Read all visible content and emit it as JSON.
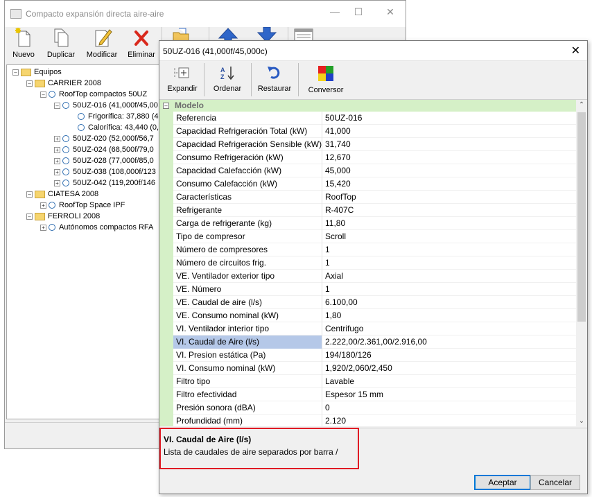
{
  "background_window": {
    "title": "Compacto expansión directa aire-aire",
    "toolbar": [
      {
        "label": "Nuevo",
        "icon": "new-document-icon"
      },
      {
        "label": "Duplicar",
        "icon": "duplicate-icon"
      },
      {
        "label": "Modificar",
        "icon": "edit-pencil-icon"
      },
      {
        "label": "Eliminar",
        "icon": "delete-x-icon"
      }
    ],
    "tree": [
      {
        "label": "Equipos"
      },
      {
        "label": "CARRIER 2008"
      },
      {
        "label": "RoofTop compactos 50UZ"
      },
      {
        "label": "50UZ-016 (41,000f/45,00"
      },
      {
        "label": "Frigorífica: 37,880 (4"
      },
      {
        "label": "Calorífica: 43,440 (0,"
      },
      {
        "label": "50UZ-020 (52,000f/56,7"
      },
      {
        "label": "50UZ-024 (68,500f/79,0"
      },
      {
        "label": "50UZ-028 (77,000f/85,0"
      },
      {
        "label": "50UZ-038 (108,000f/123"
      },
      {
        "label": "50UZ-042 (119,200f/146"
      },
      {
        "label": "CIATESA 2008"
      },
      {
        "label": "RoofTop Space IPF"
      },
      {
        "label": "FERROLI 2008"
      },
      {
        "label": "Autónomos compactos RFA"
      }
    ]
  },
  "dialog": {
    "title": "50UZ-016 (41,000f/45,000c)",
    "toolbar": {
      "expand": "Expandir",
      "sort": "Ordenar",
      "restore": "Restaurar",
      "converter": "Conversor"
    },
    "category": "Modelo",
    "properties": [
      {
        "name": "Referencia",
        "value": "50UZ-016"
      },
      {
        "name": "Capacidad Refrigeración Total (kW)",
        "value": "41,000"
      },
      {
        "name": "Capacidad Refrigeración Sensible (kW)",
        "value": "31,740"
      },
      {
        "name": "Consumo Refrigeración (kW)",
        "value": "12,670"
      },
      {
        "name": "Capacidad Calefacción (kW)",
        "value": "45,000"
      },
      {
        "name": "Consumo Calefacción (kW)",
        "value": "15,420"
      },
      {
        "name": "Características",
        "value": "RoofTop"
      },
      {
        "name": "Refrigerante",
        "value": "R-407C"
      },
      {
        "name": "Carga de refrigerante (kg)",
        "value": "11,80"
      },
      {
        "name": "Tipo de compresor",
        "value": "Scroll"
      },
      {
        "name": "Número de compresores",
        "value": "1"
      },
      {
        "name": "Número de circuitos frig.",
        "value": "1"
      },
      {
        "name": "VE. Ventilador exterior tipo",
        "value": "Axial"
      },
      {
        "name": "VE. Número",
        "value": "1"
      },
      {
        "name": "VE. Caudal de aire (l/s)",
        "value": "6.100,00"
      },
      {
        "name": "VE. Consumo nominal (kW)",
        "value": "1,80"
      },
      {
        "name": "VI. Ventilador interior tipo",
        "value": "Centrifugo"
      },
      {
        "name": "VI. Caudal de Aire (l/s)",
        "value": "2.222,00/2.361,00/2.916,00"
      },
      {
        "name": "VI. Presion estática (Pa)",
        "value": "194/180/126"
      },
      {
        "name": "VI. Consumo nominal (kW)",
        "value": "1,920/2,060/2,450"
      },
      {
        "name": "Filtro tipo",
        "value": "Lavable"
      },
      {
        "name": "Filtro efectividad",
        "value": "Espesor 15 mm"
      },
      {
        "name": "Presión sonora (dBA)",
        "value": "0"
      },
      {
        "name": "Profundidad (mm)",
        "value": "2.120"
      }
    ],
    "selected_index": 17,
    "description": {
      "title": "VI. Caudal de Aire (l/s)",
      "text": "Lista de caudales de aire separados por barra /"
    },
    "buttons": {
      "accept": "Aceptar",
      "cancel": "Cancelar"
    }
  },
  "colors": {
    "category_bg": "#d5f0c7",
    "selection_bg": "#b5c8e8",
    "highlight_box": "#e01a24",
    "default_button_border": "#0078d7"
  }
}
